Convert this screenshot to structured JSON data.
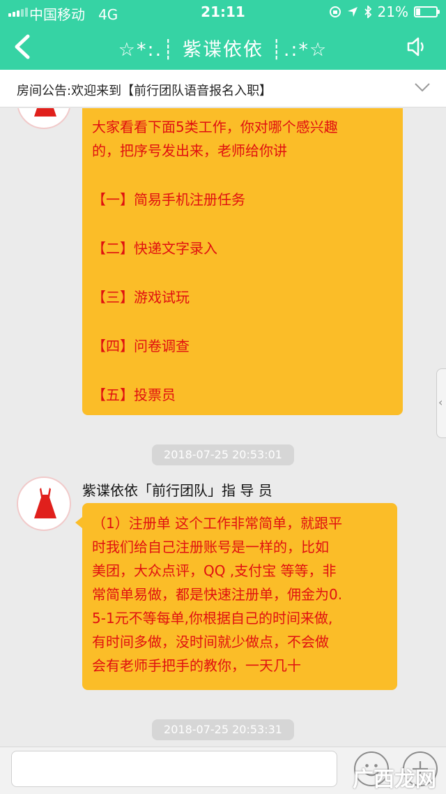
{
  "status": {
    "carrier": "中国移动",
    "network": "4G",
    "time": "21:11",
    "battery": "21%"
  },
  "nav": {
    "title": "☆*:.┊ 紫谍依依 ┊.:*☆"
  },
  "notice": {
    "text": "房间公告:欢迎来到【前行团队语音报名入职】"
  },
  "messages": [
    {
      "lines": [
        "大家看看下面5类工作，你对哪个感兴趣",
        "的，把序号发出来，老师给你讲"
      ],
      "options": [
        "【一】简易手机注册任务",
        "【二】快递文字录入",
        "【三】游戏试玩",
        "【四】问卷调查",
        "【五】投票员"
      ]
    },
    {
      "timestamp": "2018-07-25 20:53:01",
      "sender": "紫谍依依「前行团队」指 导 员",
      "lines": [
        "（1）注册单  这个工作非常简单，就跟平",
        "时我们给自己注册账号是一样的，比如",
        "美团，大众点评，QQ ,支付宝 等等，非",
        "常简单易做，都是快速注册单，佣金为0.",
        "5-1元不等每单,你根据自己的时间来做,",
        "有时间多做，没时间就少做点，不会做",
        "会有老师手把手的教你，一天几十"
      ]
    },
    {
      "timestamp": "2018-07-25 20:53:31"
    }
  ],
  "side_handle": "‹",
  "watermark": "广西龙网",
  "colors": {
    "header": "#36d3a4",
    "bubble": "#fbbd28",
    "message_text": "#e01010",
    "avatar_dress": "#e0201c"
  },
  "icons": {
    "back": "chevron-left-icon",
    "speaker": "speaker-icon",
    "notice_toggle": "chevron-down-icon",
    "avatar": "red-dress-icon",
    "emoji": "emoji-icon",
    "plus": "plus-icon"
  }
}
